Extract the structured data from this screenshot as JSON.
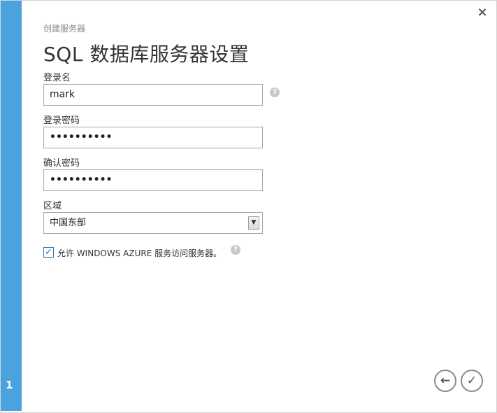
{
  "wizard": {
    "subtitle": "创建服务器",
    "title": "SQL 数据库服务器设置",
    "step": "1",
    "close": "×"
  },
  "form": {
    "login_name_label": "登录名",
    "login_name_value": "mark",
    "password_label": "登录密码",
    "password_value": "••••••••••",
    "confirm_label": "确认密码",
    "confirm_value": "••••••••••",
    "region_label": "区域",
    "region_value": "中国东部",
    "allow_label": "允许 WINDOWS AZURE 服务访问服务器。",
    "allow_checked": true,
    "help": "?"
  },
  "nav": {
    "back": "←",
    "finish": "✓"
  },
  "colors": {
    "accent": "#4aa3df",
    "checkbox": "#2a7fc2"
  }
}
